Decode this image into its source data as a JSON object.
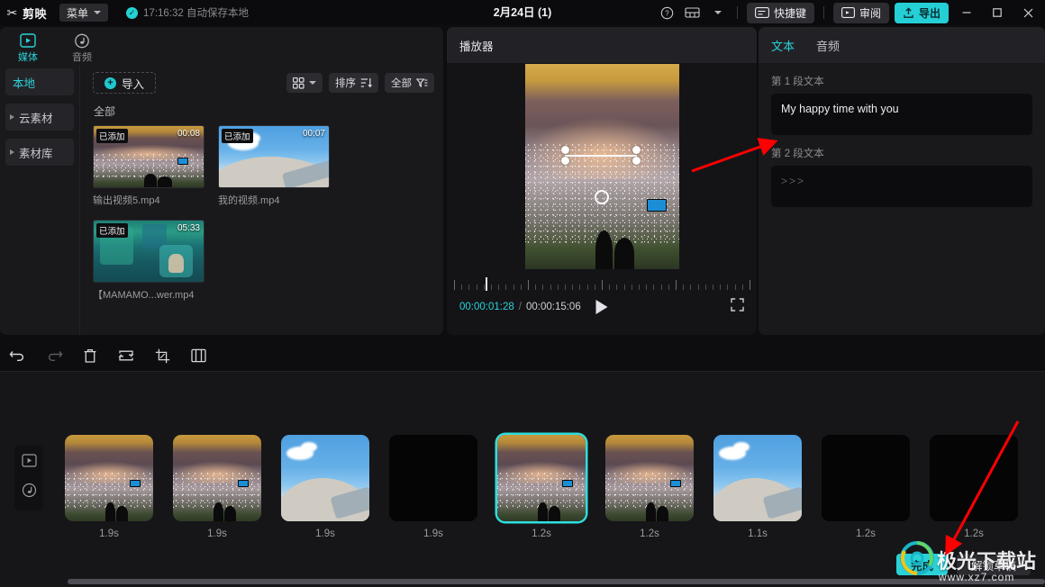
{
  "titlebar": {
    "app_name": "剪映",
    "logo_icon": "scissors-logo-icon",
    "menu_label": "菜单",
    "autosave_text": "17:16:32 自动保存本地",
    "autosave_icon": "check-circle-icon",
    "doc_title": "2月24日 (1)",
    "help_icon": "help-circle-icon",
    "layout_icon": "layout-icon",
    "shortcut_icon": "keyboard-icon",
    "shortcut_label": "快捷键",
    "review_icon": "review-screen-icon",
    "review_label": "审阅",
    "export_icon": "export-upload-icon",
    "export_label": "导出",
    "minimize_label": "—",
    "maximize_label": "▢",
    "close_label": "✕"
  },
  "media": {
    "tabs": [
      {
        "label": "媒体",
        "icon": "media-play-icon",
        "active": true
      },
      {
        "label": "音频",
        "icon": "audio-note-icon",
        "active": false
      }
    ],
    "side_items": [
      {
        "label": "本地",
        "active": true,
        "expandable": false
      },
      {
        "label": "云素材",
        "active": false,
        "expandable": true
      },
      {
        "label": "素材库",
        "active": false,
        "expandable": true
      }
    ],
    "import_label": "导入",
    "import_icon": "plus-circle-icon",
    "view_icon": "grid-view-icon",
    "view_caret_icon": "chevron-down-icon",
    "sort_label": "排序",
    "sort_icon": "sort-icon",
    "filter_label": "全部",
    "filter_icon": "filter-icon",
    "all_label": "全部",
    "clips": [
      {
        "name": "输出视频5.mp4",
        "duration": "00:08",
        "badge": "已添加",
        "scene": "fireworks"
      },
      {
        "name": "我的视频.mp4",
        "duration": "00:07",
        "badge": "已添加",
        "scene": "hill"
      },
      {
        "name": "【MAMAMO...wer.mp4",
        "duration": "05:33",
        "badge": "已添加",
        "scene": "aquarium"
      }
    ]
  },
  "player": {
    "title": "播放器",
    "current_time": "00:00:01:28",
    "separator": "/",
    "total_time": "00:00:15:06",
    "play_icon": "play-triangle-icon",
    "fullscreen_icon": "fullscreen-icon",
    "rotate_icon": "rotate-handle-icon"
  },
  "text_panel": {
    "tabs": [
      {
        "label": "文本",
        "active": true
      },
      {
        "label": "音频",
        "active": false
      }
    ],
    "fields": [
      {
        "label": "第 1 段文本",
        "value": "My happy time with you",
        "placeholder": ""
      },
      {
        "label": "第 2 段文本",
        "value": "",
        "placeholder": ">>>"
      }
    ]
  },
  "timeline_toolbar": [
    {
      "name": "undo",
      "icon": "undo-arrow-icon",
      "dim": false
    },
    {
      "name": "redo",
      "icon": "redo-arrow-icon",
      "dim": true
    },
    {
      "name": "delete",
      "icon": "trash-icon",
      "dim": false
    },
    {
      "name": "replace",
      "icon": "replace-loop-icon",
      "dim": false
    },
    {
      "name": "crop",
      "icon": "crop-icon",
      "dim": false
    },
    {
      "name": "split-view",
      "icon": "split-view-icon",
      "dim": false
    }
  ],
  "timeline": {
    "track_controls": [
      {
        "icon": "video-track-icon"
      },
      {
        "icon": "audio-track-icon"
      }
    ],
    "clips": [
      {
        "duration": "1.9s",
        "scene": "fireworks",
        "selected": false
      },
      {
        "duration": "1.9s",
        "scene": "fireworks",
        "selected": false
      },
      {
        "duration": "1.9s",
        "scene": "hill",
        "selected": false
      },
      {
        "duration": "1.9s",
        "scene": "black",
        "selected": false
      },
      {
        "duration": "1.2s",
        "scene": "fireworks",
        "selected": true
      },
      {
        "duration": "1.2s",
        "scene": "fireworks",
        "selected": false
      },
      {
        "duration": "1.1s",
        "scene": "hill",
        "selected": false
      },
      {
        "duration": "1.2s",
        "scene": "black",
        "selected": false
      },
      {
        "duration": "1.2s",
        "scene": "black",
        "selected": false
      }
    ]
  },
  "bottom_buttons": [
    {
      "label": "完成",
      "style": "primary"
    },
    {
      "label": "解锁草稿",
      "style": "ghost"
    }
  ],
  "watermark": {
    "title": "极光下载站",
    "subtitle": "www.xz7.com",
    "logo_icon": "aurora-spiral-logo-icon"
  },
  "colors": {
    "accent": "#2ad2d8",
    "selection": "#2fdede",
    "arrow": "#ff0000",
    "panel_bg": "#19191c"
  }
}
